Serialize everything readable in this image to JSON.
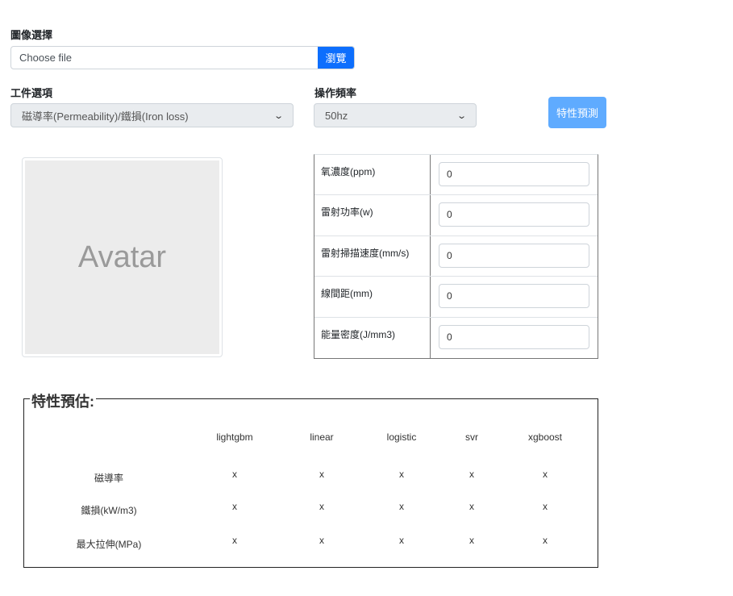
{
  "image_select": {
    "label": "圖像選擇",
    "placeholder": "Choose file",
    "browse": "瀏覽"
  },
  "workpiece": {
    "label": "工件選項",
    "value": "磁導率(Permeability)/鐵損(Iron loss)"
  },
  "frequency": {
    "label": "操作頻率",
    "value": "50hz"
  },
  "predict_button": "特性預測",
  "avatar": "Avatar",
  "params": [
    {
      "label": "氧濃度(ppm)",
      "value": "0"
    },
    {
      "label": "雷射功率(w)",
      "value": "0"
    },
    {
      "label": "雷射掃描速度(mm/s)",
      "value": "0"
    },
    {
      "label": "線間距(mm)",
      "value": "0"
    },
    {
      "label": "能量密度(J/mm3)",
      "value": "0"
    }
  ],
  "results": {
    "title": "特性預估:",
    "columns": [
      "lightgbm",
      "linear",
      "logistic",
      "svr",
      "xgboost"
    ],
    "rows": [
      {
        "label": "磁導率",
        "values": [
          "x",
          "x",
          "x",
          "x",
          "x"
        ]
      },
      {
        "label": "鐵損(kW/m3)",
        "values": [
          "x",
          "x",
          "x",
          "x",
          "x"
        ]
      },
      {
        "label": "最大拉伸(MPa)",
        "values": [
          "x",
          "x",
          "x",
          "x",
          "x"
        ]
      }
    ]
  },
  "colors": {
    "primary": "#0d6efd",
    "predict": "#5fabff"
  }
}
